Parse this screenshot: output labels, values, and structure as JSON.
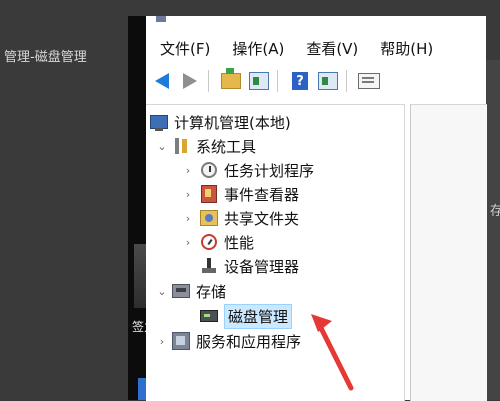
{
  "background": {
    "left_title": "管理-磁盘管理",
    "left_cut_char": "签力",
    "right_cut_char": "存"
  },
  "menu": {
    "file": "文件(F)",
    "action": "操作(A)",
    "view": "查看(V)",
    "help": "帮助(H)"
  },
  "toolbar": {
    "buttons": [
      {
        "icon": "back-arrow-icon"
      },
      {
        "icon": "forward-arrow-icon"
      },
      {
        "icon": "up-folder-icon"
      },
      {
        "icon": "show-hide-console-tree-icon"
      },
      {
        "icon": "help-icon"
      },
      {
        "icon": "show-hide-action-pane-icon"
      },
      {
        "icon": "properties-list-icon"
      }
    ],
    "help_glyph": "?"
  },
  "tree": {
    "root": "计算机管理(本地)",
    "system_tools": "系统工具",
    "task_scheduler": "任务计划程序",
    "event_viewer": "事件查看器",
    "shared_folders": "共享文件夹",
    "performance": "性能",
    "device_manager": "设备管理器",
    "storage": "存储",
    "disk_management": "磁盘管理",
    "services_apps": "服务和应用程序"
  },
  "expanders": {
    "expanded": "⌄",
    "collapsed": "›"
  },
  "colors": {
    "annotation_arrow": "#e53935",
    "selection_bg": "#cce8ff",
    "selection_border": "#99d1ff"
  }
}
